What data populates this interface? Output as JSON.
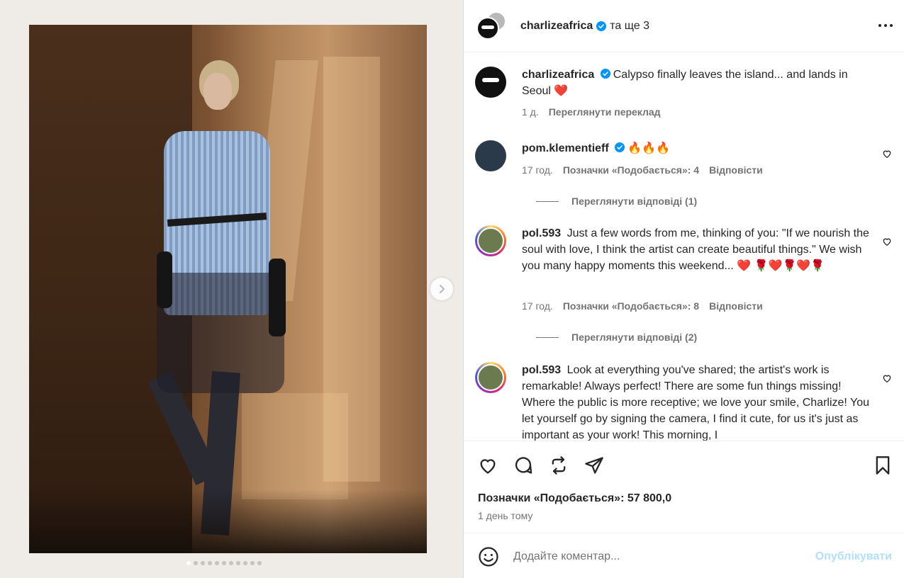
{
  "post": {
    "author": "charlizeafrica",
    "collab_text": "та ще 3",
    "caption_text": "Calypso finally leaves the island... and lands in Seoul",
    "caption_emoji": "❤️",
    "caption_time": "1 д.",
    "see_translation": "Переглянути переклад",
    "media_total": 11,
    "media_index": 1
  },
  "comments": [
    {
      "user": "pom.klementieff",
      "verified": true,
      "text": "🔥🔥🔥",
      "time": "17 год.",
      "likes": "Позначки «Подобається»: 4",
      "reply": "Відповісти",
      "view_replies": "Переглянути відповіді (1)"
    },
    {
      "user": "pol.593",
      "verified": false,
      "text": "Just a few words from me, thinking of you: \"If we nourish the soul with love, I think the artist can create beautiful things.\" We wish you many happy moments this weekend... ❤️ 🌹❤️🌹❤️🌹",
      "time": "17 год.",
      "likes": "Позначки «Подобається»: 8",
      "reply": "Відповісти",
      "view_replies": "Переглянути відповіді (2)"
    },
    {
      "user": "pol.593",
      "verified": false,
      "text": "Look at everything you've shared; the artist's work is remarkable! Always perfect! There are some fun things missing! Where the public is more receptive; we love your smile, Charlize! You let yourself go by signing the camera, I find it cute, for us it's just as important as your work! This morning, I"
    }
  ],
  "actions": {
    "likes_text": "Позначки «Подобається»: 57 800,0",
    "posted_time": "1 день тому"
  },
  "composer": {
    "placeholder": "Додайте коментар...",
    "publish_label": "Опублікувати"
  },
  "colors": {
    "verified": "#0095f6",
    "publish_disabled": "#b2dffc",
    "muted": "#737373"
  },
  "icons": {
    "header": "more-horizontal-icon",
    "like": "heart-icon",
    "comment": "comment-bubble-icon",
    "repost": "repost-icon",
    "share": "paper-plane-icon",
    "save": "bookmark-icon",
    "emoji": "smiley-icon",
    "next": "chevron-right-icon"
  }
}
